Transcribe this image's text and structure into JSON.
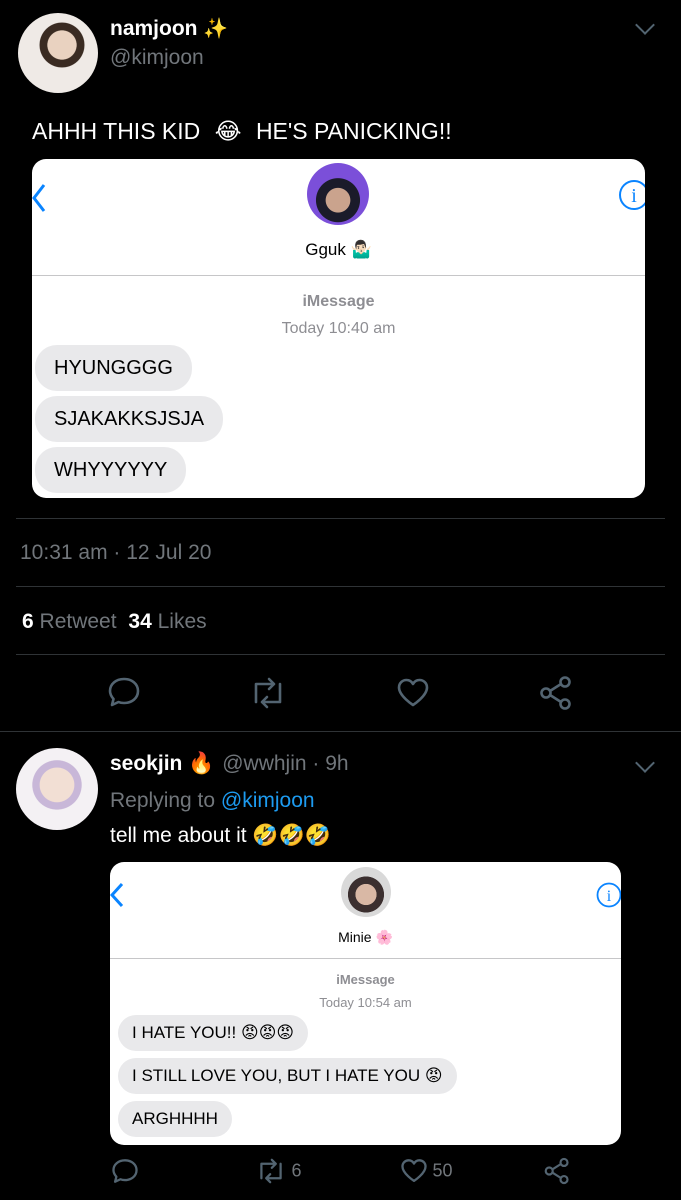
{
  "tweet": {
    "display_name": "namjoon",
    "name_emoji": "✨",
    "handle": "@kimjoon",
    "text_before_emoji": "AHHH THIS KID",
    "text_emoji": "😂",
    "text_after_emoji": "HE'S PANICKING!!",
    "screenshot": {
      "contact_name": "Gguk",
      "contact_emoji": "🤷🏻‍♂️",
      "service": "iMessage",
      "timestamp": "Today 10:40 am",
      "messages": [
        "HYUNGGGG",
        "SJAKAKKSJSJA",
        "WHYYYYYY"
      ]
    },
    "time": "10:31 am · 12 Jul 20",
    "retweet_count": "6",
    "retweet_label": "Retweet",
    "like_count": "34",
    "like_label": "Likes"
  },
  "reply": {
    "display_name": "seokjin",
    "name_emoji": "🔥",
    "handle": "@wwhjin",
    "time": "· 9h",
    "replying_to_label": "Replying to",
    "replying_to_handle": "@kimjoon",
    "text": "tell me about it",
    "text_emojis": "🤣🤣🤣",
    "screenshot": {
      "contact_name": "Minie",
      "contact_emoji": "🌸",
      "service": "iMessage",
      "timestamp": "Today 10:54 am",
      "messages": [
        {
          "text": "I HATE YOU!!",
          "emoji": "😡😡😡"
        },
        {
          "text": "I STILL LOVE YOU, BUT I HATE YOU",
          "emoji": "😡"
        },
        {
          "text": "ARGHHHH",
          "emoji": ""
        }
      ]
    },
    "retweet_count": "6",
    "like_count": "50"
  },
  "colors": {
    "background": "#000000",
    "muted": "#71767b",
    "link": "#1d9bf0",
    "ios_blue": "#0a84ff",
    "bubble": "#e9e9eb"
  }
}
